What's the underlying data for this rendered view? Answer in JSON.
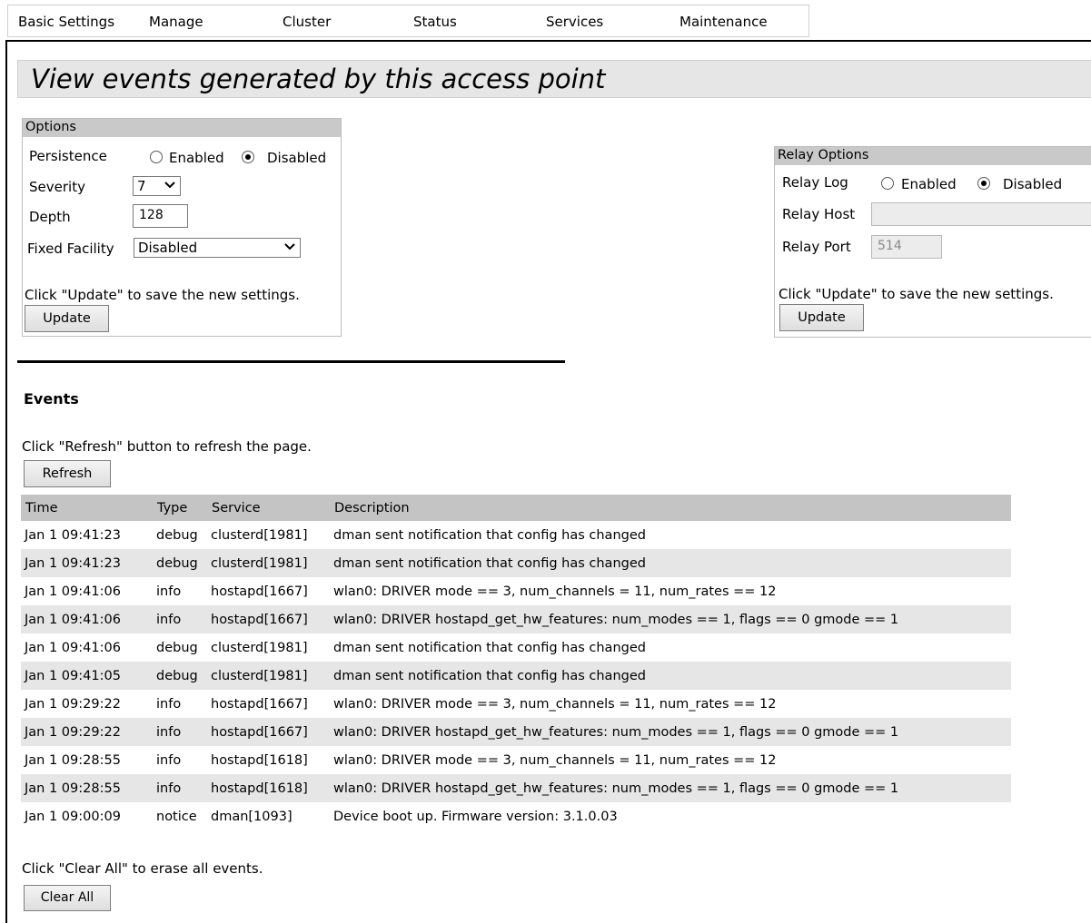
{
  "nav": {
    "items": [
      "Basic Settings",
      "Manage",
      "Cluster",
      "Status",
      "Services",
      "Maintenance"
    ]
  },
  "page_title": "View events generated by this access point",
  "options": {
    "header": "Options",
    "persistence_label": "Persistence",
    "persistence_enabled_label": "Enabled",
    "persistence_disabled_label": "Disabled",
    "persistence_selected": "Disabled",
    "severity_label": "Severity",
    "severity_value": "7",
    "depth_label": "Depth",
    "depth_value": "128",
    "fixed_facility_label": "Fixed Facility",
    "fixed_facility_value": "Disabled",
    "hint": "Click \"Update\" to save the new settings.",
    "update_label": "Update"
  },
  "relay_options": {
    "header": "Relay Options",
    "relay_log_label": "Relay Log",
    "relay_log_enabled_label": "Enabled",
    "relay_log_disabled_label": "Disabled",
    "relay_log_selected": "Disabled",
    "relay_host_label": "Relay Host",
    "relay_host_value": "",
    "relay_port_label": "Relay Port",
    "relay_port_value": "514",
    "hint": "Click \"Update\" to save the new settings.",
    "update_label": "Update"
  },
  "events": {
    "heading": "Events",
    "refresh_hint": "Click \"Refresh\" button to refresh the page.",
    "refresh_label": "Refresh",
    "columns": [
      "Time",
      "Type",
      "Service",
      "Description"
    ],
    "rows": [
      {
        "time": "Jan 1 09:41:23",
        "type": "debug",
        "service": "clusterd[1981]",
        "description": "dman sent notification that config has changed"
      },
      {
        "time": "Jan 1 09:41:23",
        "type": "debug",
        "service": "clusterd[1981]",
        "description": "dman sent notification that config has changed"
      },
      {
        "time": "Jan 1 09:41:06",
        "type": "info",
        "service": "hostapd[1667]",
        "description": "wlan0: DRIVER mode == 3, num_channels = 11, num_rates == 12"
      },
      {
        "time": "Jan 1 09:41:06",
        "type": "info",
        "service": "hostapd[1667]",
        "description": "wlan0: DRIVER hostapd_get_hw_features: num_modes == 1, flags == 0 gmode == 1"
      },
      {
        "time": "Jan 1 09:41:06",
        "type": "debug",
        "service": "clusterd[1981]",
        "description": "dman sent notification that config has changed"
      },
      {
        "time": "Jan 1 09:41:05",
        "type": "debug",
        "service": "clusterd[1981]",
        "description": "dman sent notification that config has changed"
      },
      {
        "time": "Jan 1 09:29:22",
        "type": "info",
        "service": "hostapd[1667]",
        "description": "wlan0: DRIVER mode == 3, num_channels = 11, num_rates == 12"
      },
      {
        "time": "Jan 1 09:29:22",
        "type": "info",
        "service": "hostapd[1667]",
        "description": "wlan0: DRIVER hostapd_get_hw_features: num_modes == 1, flags == 0 gmode == 1"
      },
      {
        "time": "Jan 1 09:28:55",
        "type": "info",
        "service": "hostapd[1618]",
        "description": "wlan0: DRIVER mode == 3, num_channels = 11, num_rates == 12"
      },
      {
        "time": "Jan 1 09:28:55",
        "type": "info",
        "service": "hostapd[1618]",
        "description": "wlan0: DRIVER hostapd_get_hw_features: num_modes == 1, flags == 0 gmode == 1"
      },
      {
        "time": "Jan 1 09:00:09",
        "type": "notice",
        "service": "dman[1093]",
        "description": "Device boot up. Firmware version: 3.1.0.03"
      }
    ],
    "clear_hint": "Click \"Clear All\" to erase all events.",
    "clear_label": "Clear All"
  }
}
